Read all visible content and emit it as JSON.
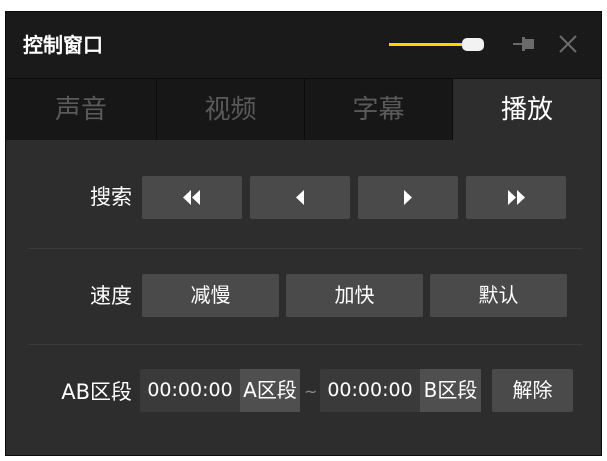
{
  "window": {
    "title": "控制窗口"
  },
  "titlebar": {
    "opacity_slider_level": 0.9,
    "slider_color": "#ffd200",
    "pin_icon": "pin-icon",
    "close_icon": "close-icon"
  },
  "tabs": [
    {
      "label": "声音",
      "active": false
    },
    {
      "label": "视频",
      "active": false
    },
    {
      "label": "字幕",
      "active": false
    },
    {
      "label": "播放",
      "active": true
    }
  ],
  "search": {
    "label": "搜索",
    "buttons": [
      "fast-rewind-icon",
      "step-back-icon",
      "step-forward-icon",
      "fast-forward-icon"
    ]
  },
  "speed": {
    "label": "速度",
    "slower": "减慢",
    "faster": "加快",
    "default": "默认"
  },
  "ab": {
    "label": "AB区段",
    "a_time": "00:00:00",
    "a_button": "A区段",
    "separator": "~",
    "b_time": "00:00:00",
    "b_button": "B区段",
    "clear": "解除"
  }
}
